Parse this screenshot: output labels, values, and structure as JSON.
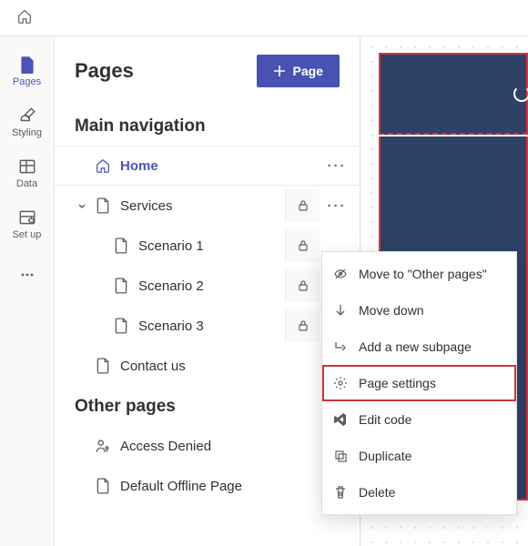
{
  "panel": {
    "title": "Pages",
    "new_page_label": "Page"
  },
  "rail": {
    "pages": "Pages",
    "styling": "Styling",
    "data": "Data",
    "setup": "Set up"
  },
  "nav": {
    "main_title": "Main navigation",
    "other_title": "Other pages",
    "home": "Home",
    "services": "Services",
    "scenario1": "Scenario 1",
    "scenario2": "Scenario 2",
    "scenario3": "Scenario 3",
    "contact": "Contact us",
    "access_denied": "Access Denied",
    "default_offline": "Default Offline Page"
  },
  "menu": {
    "move_other": "Move to \"Other pages\"",
    "move_down": "Move down",
    "add_subpage": "Add a new subpage",
    "page_settings": "Page settings",
    "edit_code": "Edit code",
    "duplicate": "Duplicate",
    "delete": "Delete"
  }
}
